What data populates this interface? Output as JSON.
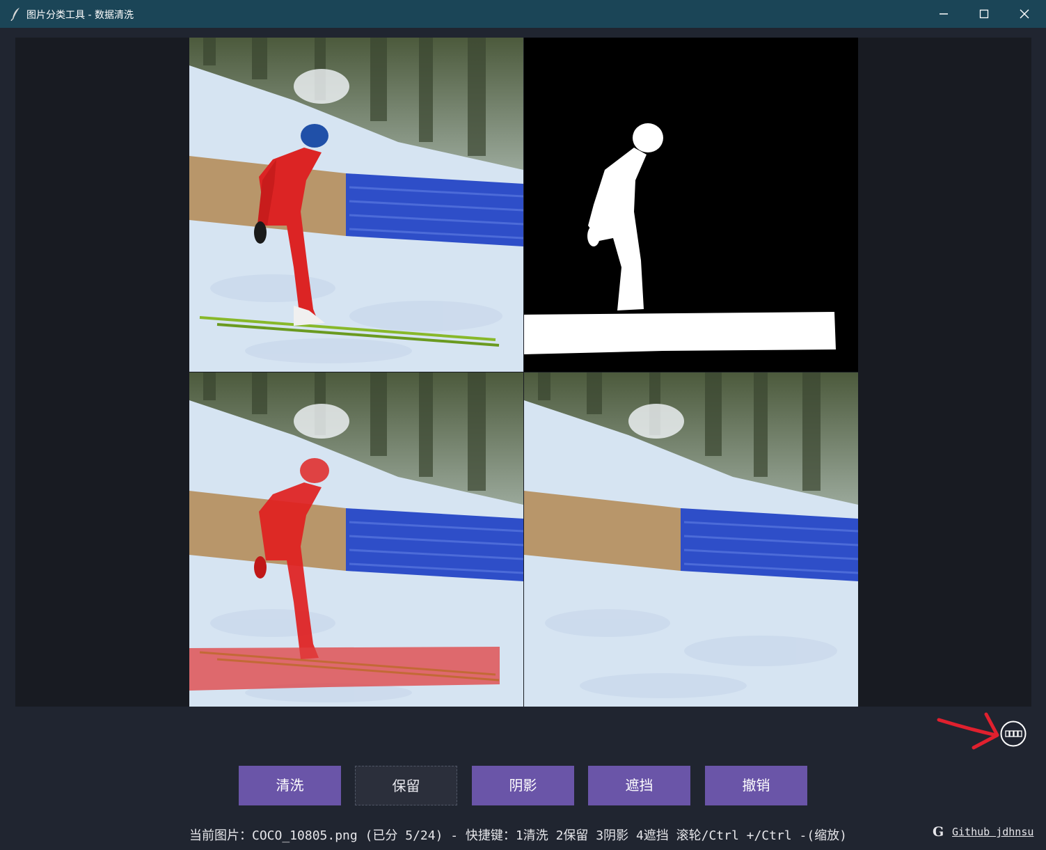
{
  "window": {
    "title": "图片分类工具 - 数据清洗",
    "icon": "feather-icon",
    "controls": [
      "minimize-icon",
      "maximize-icon",
      "close-icon"
    ]
  },
  "viewer": {
    "panels": [
      "original-image",
      "mask-image",
      "overlay-image",
      "shadow-removed-image"
    ],
    "mask_color": "#e02020"
  },
  "buttons": {
    "clean": "清洗",
    "keep": "保留",
    "shadow": "阴影",
    "occlusion": "遮挡",
    "undo": "撤销"
  },
  "status": {
    "text": "当前图片：COCO_10805.png (已分 5/24) - 快捷键：1清洗 2保留 3阴影 4遮挡  滚轮/Ctrl +/Ctrl -(缩放)"
  },
  "footer": {
    "github_icon": "G",
    "github_link": "Github jdhnsu"
  },
  "colors": {
    "titlebar": "#1b4557",
    "background": "#202530",
    "button": "#6a55a8",
    "annotation_arrow": "#e0202e"
  }
}
